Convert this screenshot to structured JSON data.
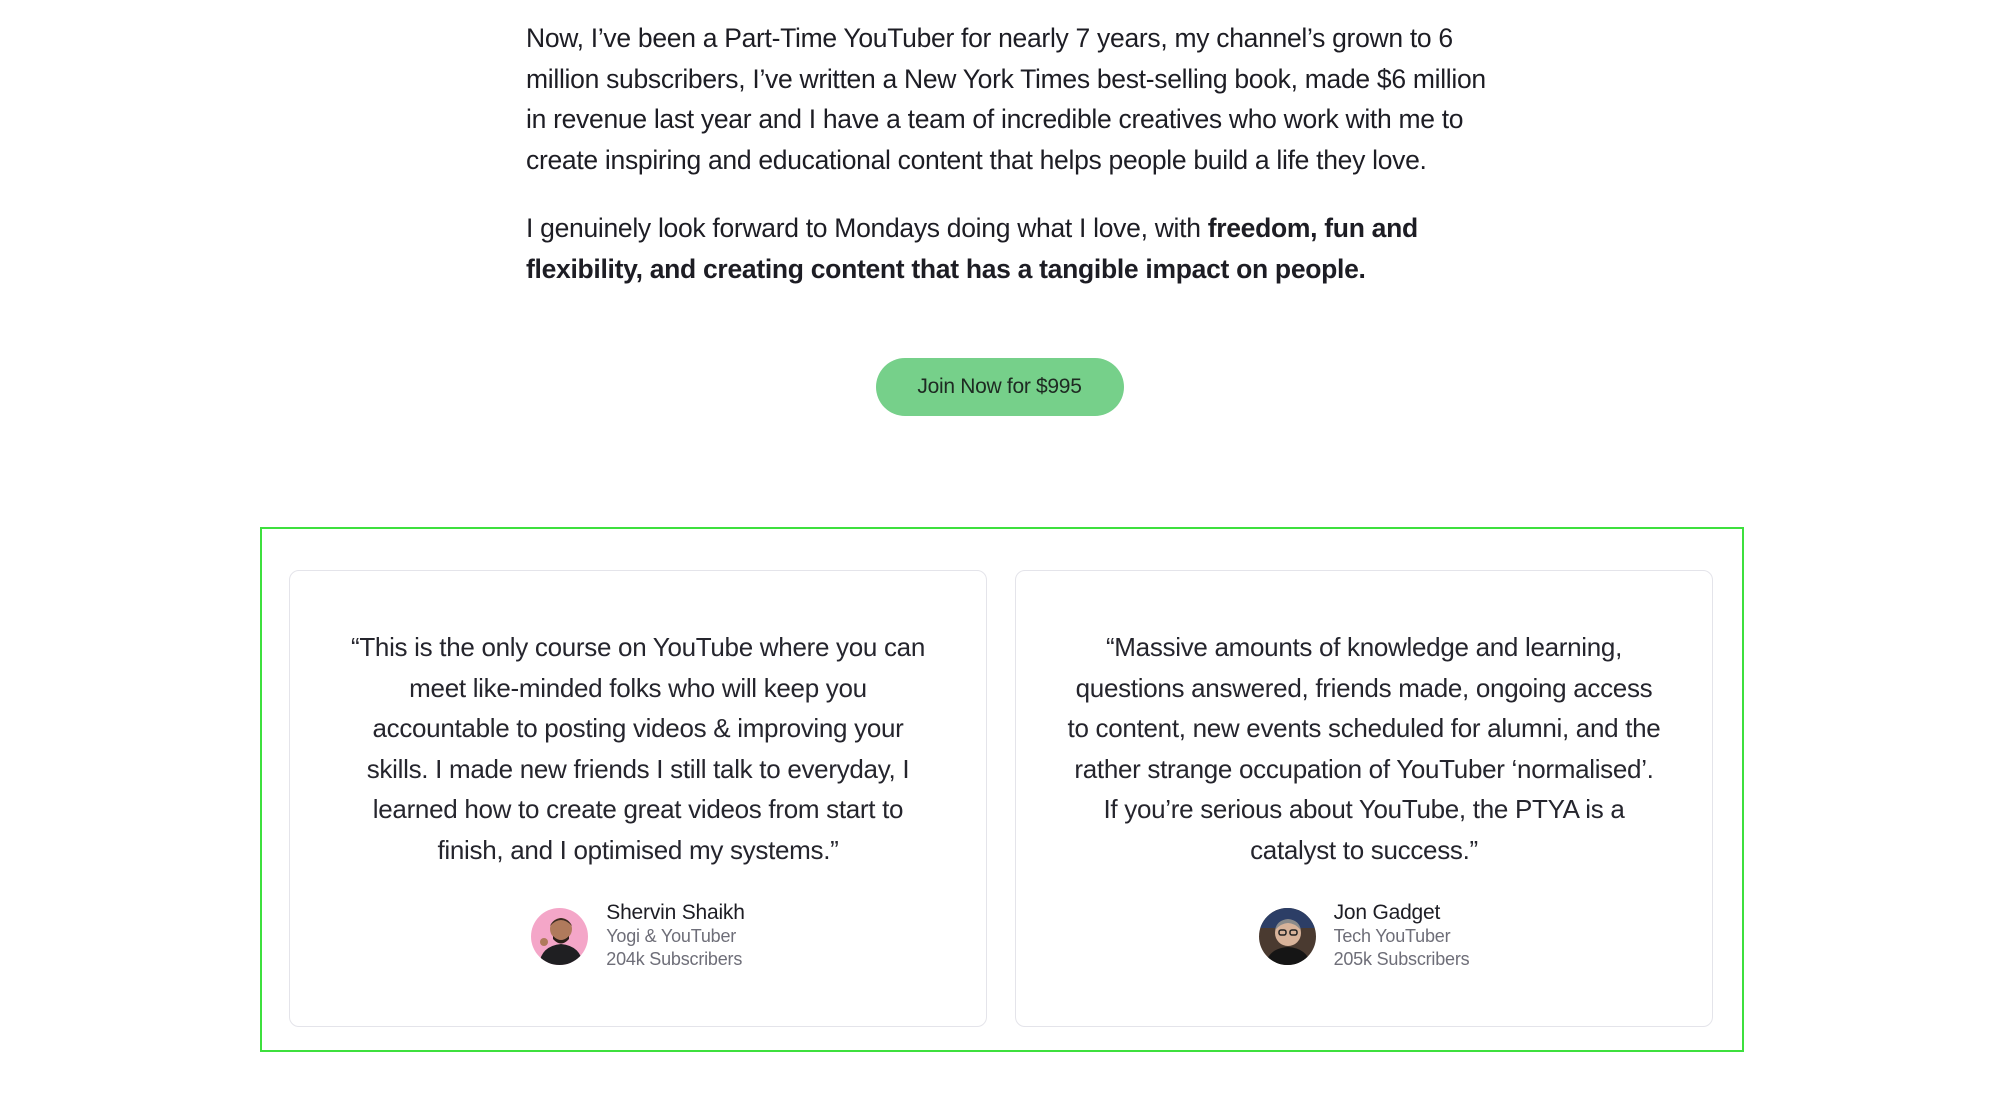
{
  "intro": {
    "paragraph1": "Now, I’ve been a Part-Time YouTuber for nearly 7 years, my channel’s grown to 6 million subscribers, I’ve written a New York Times best-selling book, made $6 million in revenue last year and I have a team of incredible creatives who work with me to create inspiring and educational content that helps people build a life they love.",
    "paragraph2_lead": "I genuinely look forward to Mondays doing what I love, with ",
    "paragraph2_bold": "freedom, fun and flexibility, and creating content that has a tangible impact on people."
  },
  "cta": {
    "label": "Join Now for $995",
    "color": "#76d08a"
  },
  "testimonials": [
    {
      "quote": "“This is the only course on YouTube where you can meet like-minded folks who will keep you accountable to posting videos & improving your skills. I made new friends I still talk to everyday, I learned how to create great videos from start to finish, and I optimised my systems.”",
      "name": "Shervin Shaikh",
      "role": "Yogi & YouTuber",
      "subscribers": "204k Subscribers",
      "avatar_bg": "#f4a6c8"
    },
    {
      "quote": "“Massive amounts of knowledge and learning, questions answered, friends made, ongoing access to content, new events scheduled for alumni, and the rather strange occupation of YouTuber ‘normalised’. If you’re serious about YouTube, the PTYA is a catalyst to success.”",
      "name": "Jon Gadget",
      "role": "Tech YouTuber",
      "subscribers": "205k Subscribers",
      "avatar_bg": "#4a3a30"
    }
  ],
  "highlight_color": "#3de03d"
}
